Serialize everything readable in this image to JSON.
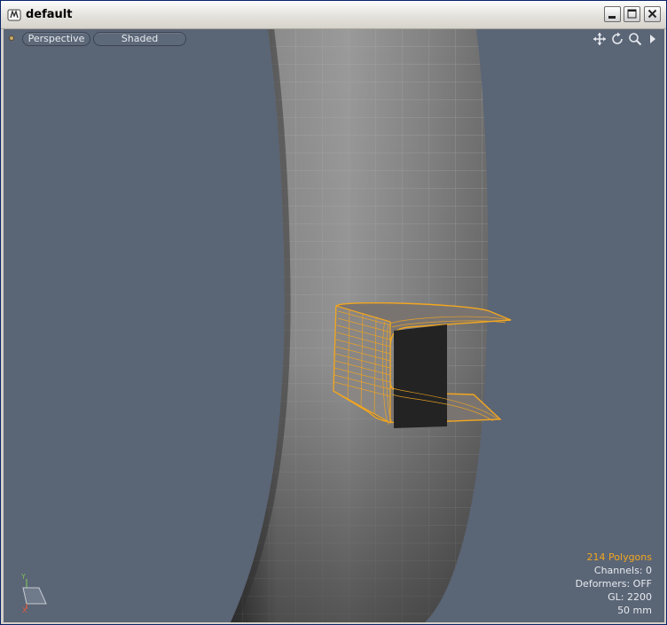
{
  "window": {
    "title": "default",
    "controls": {
      "minimize": "minimize-icon",
      "maximize": "maximize-icon",
      "close": "close-icon"
    }
  },
  "viewport": {
    "view_mode": "Perspective",
    "shading_mode": "Shaded",
    "nav_icons": [
      "pan-icon",
      "rotate-icon",
      "zoom-icon",
      "expand-arrow-icon"
    ],
    "stats": {
      "polygons": "214 Polygons",
      "channels": "Channels: 0",
      "deformers": "Deformers: OFF",
      "gl": "GL: 2200",
      "lens": "50 mm"
    },
    "axis_labels": {
      "y": "Y",
      "x": "X"
    }
  },
  "colors": {
    "viewport_bg": "#5a6576",
    "selection": "#f2a61f",
    "mesh_light": "#8f8f8f",
    "mesh_dark": "#3a3a3a"
  }
}
